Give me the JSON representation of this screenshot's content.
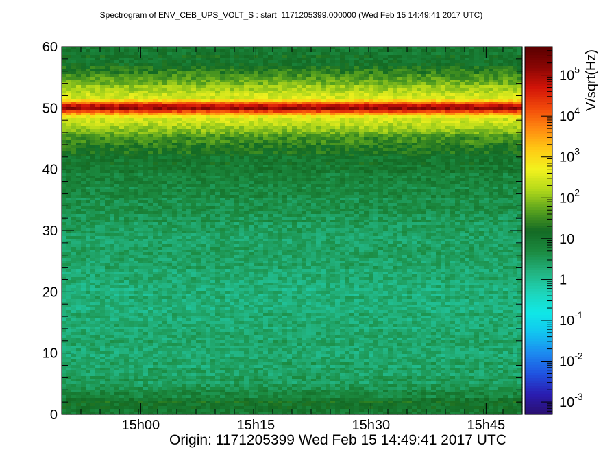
{
  "chart_data": {
    "type": "heatmap",
    "title": "Spectrogram of ENV_CEB_UPS_VOLT_S : start=1171205399.000000 (Wed Feb 15 14:49:41 2017 UTC)",
    "footer": "Origin: 1171205399  Wed Feb 15 14:49:41 2017 UTC",
    "xlabel": "",
    "ylabel": "",
    "ylim": [
      0,
      60
    ],
    "xlim_minutes_after_origin": [
      0,
      60
    ],
    "x_ticks": [
      {
        "label": "15h00",
        "minute": 10.3
      },
      {
        "label": "15h15",
        "minute": 25.3
      },
      {
        "label": "15h30",
        "minute": 40.3
      },
      {
        "label": "15h45",
        "minute": 55.3
      }
    ],
    "y_ticks": [
      0,
      10,
      20,
      30,
      40,
      50,
      60
    ],
    "colorbar": {
      "label": "V/sqrt(Hz)",
      "scale": "log",
      "range": [
        0.0005,
        500000
      ],
      "tick_labels": [
        {
          "base": "10",
          "exp": "-3",
          "value": 0.001
        },
        {
          "base": "10",
          "exp": "-2",
          "value": 0.01
        },
        {
          "base": "10",
          "exp": "-1",
          "value": 0.1
        },
        {
          "base": "1",
          "exp": "",
          "value": 1
        },
        {
          "base": "10",
          "exp": "",
          "value": 10
        },
        {
          "base": "10",
          "exp": "2",
          "value": 100
        },
        {
          "base": "10",
          "exp": "3",
          "value": 1000
        },
        {
          "base": "10",
          "exp": "4",
          "value": 10000
        },
        {
          "base": "10",
          "exp": "5",
          "value": 100000
        }
      ],
      "palette": [
        "#2a0f6e",
        "#2a1cb0",
        "#1f52e0",
        "#1c8af0",
        "#12c4f0",
        "#10e8e6",
        "#1ed4b8",
        "#22b27e",
        "#1b8a40",
        "#146a24",
        "#58a21e",
        "#b2d81a",
        "#f2f21e",
        "#ffca14",
        "#ff8a10",
        "#f24a0a",
        "#d21408",
        "#8a0604",
        "#5a0000"
      ]
    },
    "spectral_profile": [
      {
        "freq": 0,
        "value": 8
      },
      {
        "freq": 1,
        "value": 12
      },
      {
        "freq": 2,
        "value": 14
      },
      {
        "freq": 3,
        "value": 6
      },
      {
        "freq": 5,
        "value": 3
      },
      {
        "freq": 10,
        "value": 2.2
      },
      {
        "freq": 20,
        "value": 1.8
      },
      {
        "freq": 30,
        "value": 3
      },
      {
        "freq": 38,
        "value": 6
      },
      {
        "freq": 42,
        "value": 12
      },
      {
        "freq": 45,
        "value": 40
      },
      {
        "freq": 47,
        "value": 150
      },
      {
        "freq": 48.5,
        "value": 400
      },
      {
        "freq": 49.5,
        "value": 20000
      },
      {
        "freq": 50,
        "value": 200000
      },
      {
        "freq": 50.6,
        "value": 20000
      },
      {
        "freq": 51.5,
        "value": 400
      },
      {
        "freq": 53,
        "value": 150
      },
      {
        "freq": 55,
        "value": 50
      },
      {
        "freq": 57,
        "value": 15
      },
      {
        "freq": 60,
        "value": 8
      }
    ]
  }
}
